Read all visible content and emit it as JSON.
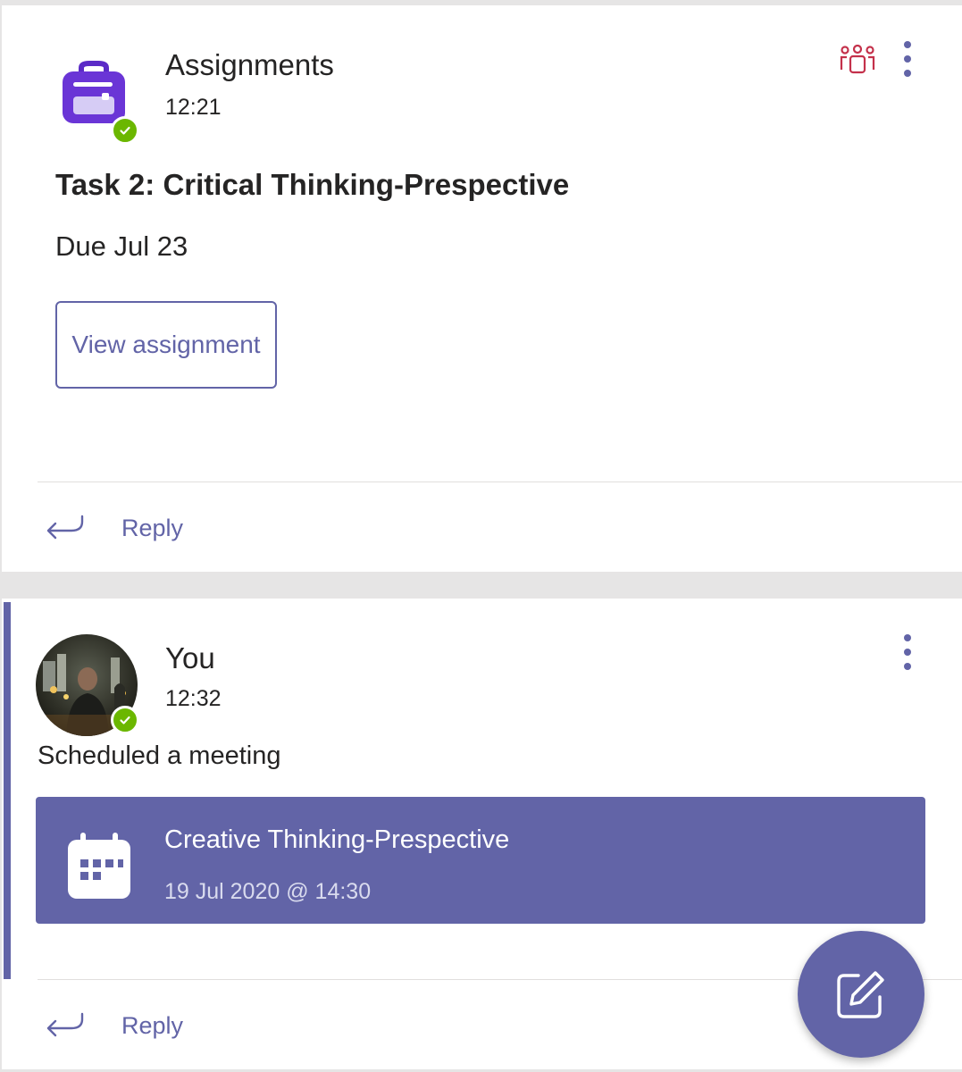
{
  "posts": [
    {
      "author": "Assignments",
      "time": "12:21",
      "icons": {
        "avatar": "assignments-backpack-icon",
        "team": "team-icon",
        "more": "more-options-icon"
      },
      "card": {
        "title": "Task 2: Critical Thinking-Prespective",
        "due": "Due Jul 23",
        "button_label": "View assignment"
      },
      "reply_label": "Reply"
    },
    {
      "author": "You",
      "time": "12:32",
      "body": "Scheduled a meeting",
      "meeting": {
        "title": "Creative Thinking-Prespective",
        "datetime": "19 Jul 2020 @ 14:30",
        "icon": "calendar-icon"
      },
      "reply_label": "Reply"
    }
  ],
  "fab": {
    "icon": "compose-icon"
  },
  "colors": {
    "accent": "#6264a7",
    "presence": "#6bb700",
    "team_icon": "#c4314b",
    "background": "#e6e5e5"
  }
}
